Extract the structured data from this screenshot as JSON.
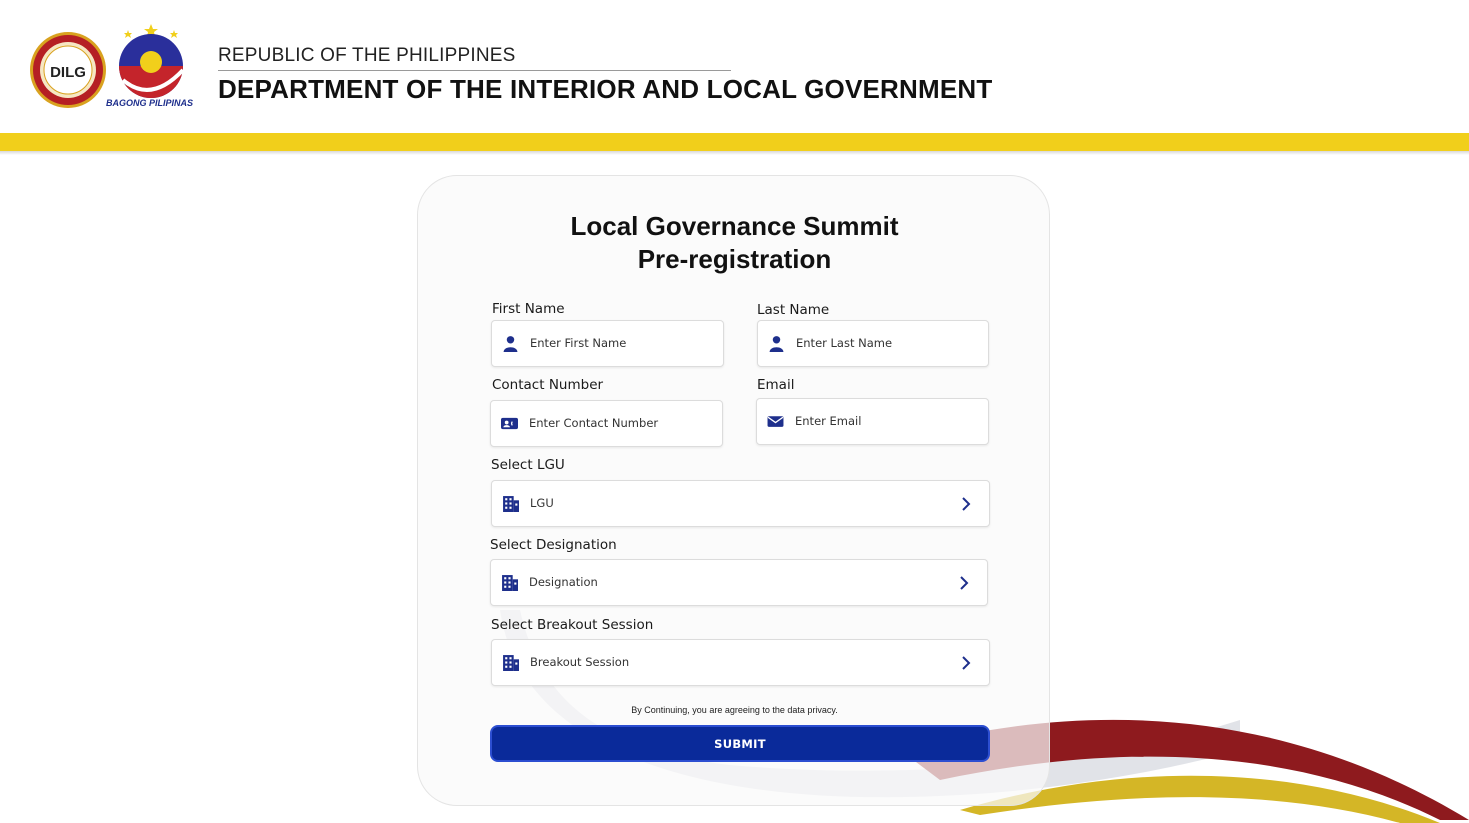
{
  "header": {
    "republic": "REPUBLIC OF THE PHILIPPINES",
    "department": "DEPARTMENT OF THE INTERIOR AND LOCAL GOVERNMENT",
    "logo_text": "DILG",
    "bagong_pilipinas": "BAGONG PILIPINAS"
  },
  "form": {
    "title_line1": "Local Governance Summit",
    "title_line2": "Pre-registration",
    "first_name": {
      "label": "First Name",
      "placeholder": "Enter First Name",
      "icon": "user-icon"
    },
    "last_name": {
      "label": "Last Name",
      "placeholder": "Enter Last Name",
      "icon": "user-icon"
    },
    "contact": {
      "label": "Contact Number",
      "placeholder": "Enter Contact Number",
      "icon": "contact-card-icon"
    },
    "email": {
      "label": "Email",
      "placeholder": "Enter Email",
      "icon": "envelope-icon"
    },
    "lgu": {
      "label": "Select LGU",
      "placeholder": "LGU",
      "icon": "building-icon"
    },
    "designation": {
      "label": "Select Designation",
      "placeholder": "Designation",
      "icon": "building-icon"
    },
    "breakout": {
      "label": "Select Breakout Session",
      "placeholder": "Breakout Session",
      "icon": "building-icon"
    },
    "privacy": "By Continuing, you are agreeing to the data privacy.",
    "submit": "SUBMIT"
  },
  "colors": {
    "accent_yellow": "#f1cf1b",
    "primary_blue": "#0a2a9a",
    "icon_blue": "#1e2f8c",
    "swoosh_red": "#8e1a1e"
  }
}
